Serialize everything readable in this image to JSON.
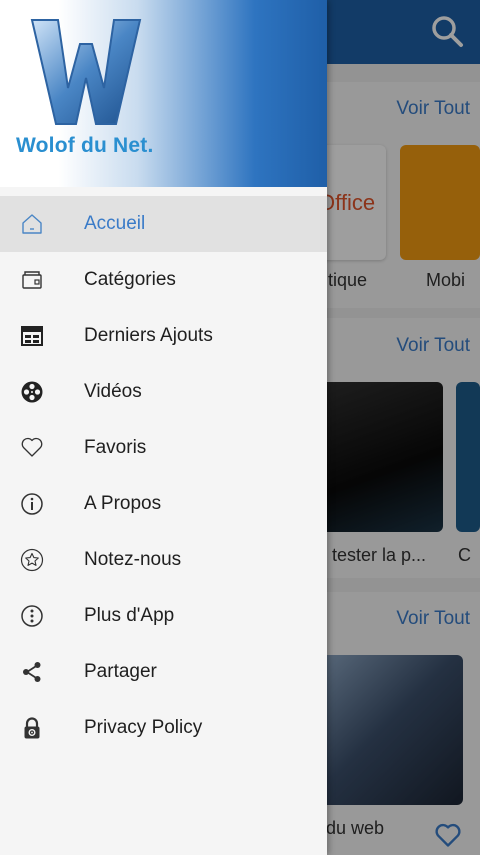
{
  "drawer": {
    "brand_text": "Wolof du Net.",
    "items": [
      {
        "label": "Accueil",
        "icon": "home-icon",
        "active": true
      },
      {
        "label": "Catégories",
        "icon": "folder-icon"
      },
      {
        "label": "Derniers Ajouts",
        "icon": "calendar-icon"
      },
      {
        "label": "Vidéos",
        "icon": "film-reel-icon"
      },
      {
        "label": "Favoris",
        "icon": "heart-icon"
      },
      {
        "label": "A Propos",
        "icon": "info-icon"
      },
      {
        "label": "Notez-nous",
        "icon": "star-icon"
      },
      {
        "label": "Plus d'App",
        "icon": "more-icon"
      },
      {
        "label": "Partager",
        "icon": "share-icon"
      },
      {
        "label": "Privacy Policy",
        "icon": "lock-icon"
      }
    ]
  },
  "background": {
    "sections": [
      {
        "see_all": "Voir Tout",
        "captions": [
          "utique",
          "Mobi"
        ],
        "tile_text": "Office"
      },
      {
        "see_all": "Voir Tout",
        "captions": [
          "tester la p...",
          "C"
        ]
      },
      {
        "see_all": "Voir Tout",
        "captions": [
          "du web"
        ]
      }
    ]
  },
  "colors": {
    "accent": "#3a7bc8",
    "appbar": "#1d5fa6"
  }
}
